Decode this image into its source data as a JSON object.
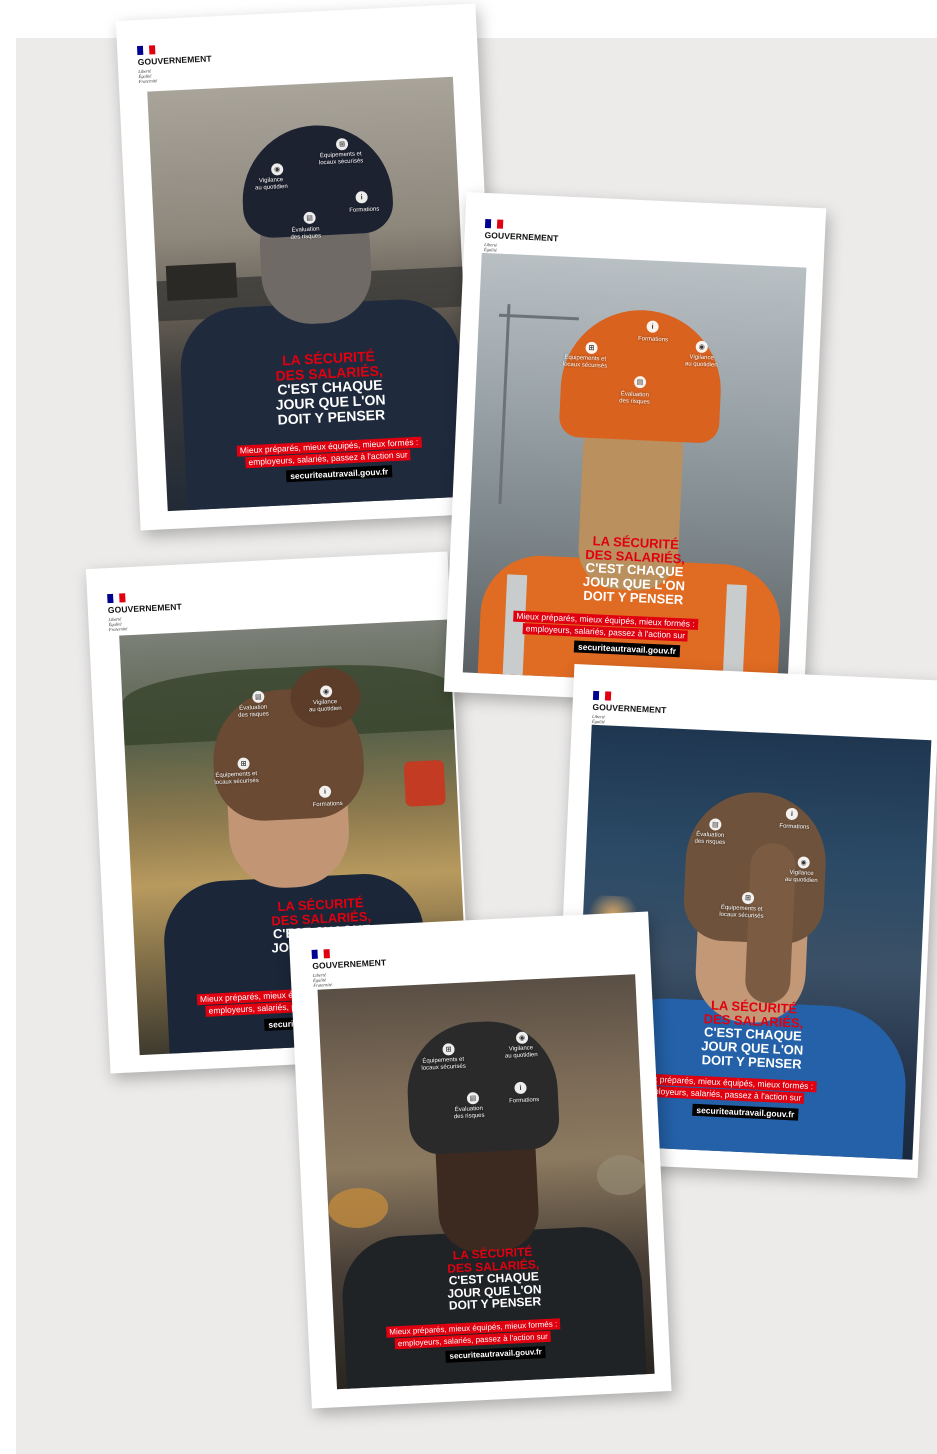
{
  "brand": {
    "gov_name": "GOUVERNEMENT",
    "motto": [
      "Liberté",
      "Égalité",
      "Fraternité"
    ],
    "flag_colors": [
      "#000091",
      "#ffffff",
      "#e1000f"
    ]
  },
  "campaign": {
    "slogan_red_1": "LA SÉCURITÉ",
    "slogan_red_2": "DES SALARIÉS,",
    "slogan_white_1": "C'EST CHAQUE",
    "slogan_white_2": "JOUR QUE L'ON",
    "slogan_white_3": "DOIT Y PENSER",
    "tagline_1": "Mieux préparés, mieux équipés, mieux formés :",
    "tagline_2": "employeurs, salariés, passez à l'action sur",
    "url": "securiteautravail.gouv.fr"
  },
  "labels": {
    "vigilance_1": "Vigilance",
    "vigilance_2": "au quotidien",
    "equipements_1": "Équipements et",
    "equipements_2": "locaux sécurisés",
    "formations": "Formations",
    "evaluation_1": "Évaluation",
    "evaluation_2": "des risques"
  },
  "icons": [
    "eye-icon",
    "safety-equipment-icon",
    "info-icon",
    "document-icon"
  ],
  "colors": {
    "accent_red": "#e1000f",
    "url_bg": "#000000",
    "background": "#ecebea"
  }
}
